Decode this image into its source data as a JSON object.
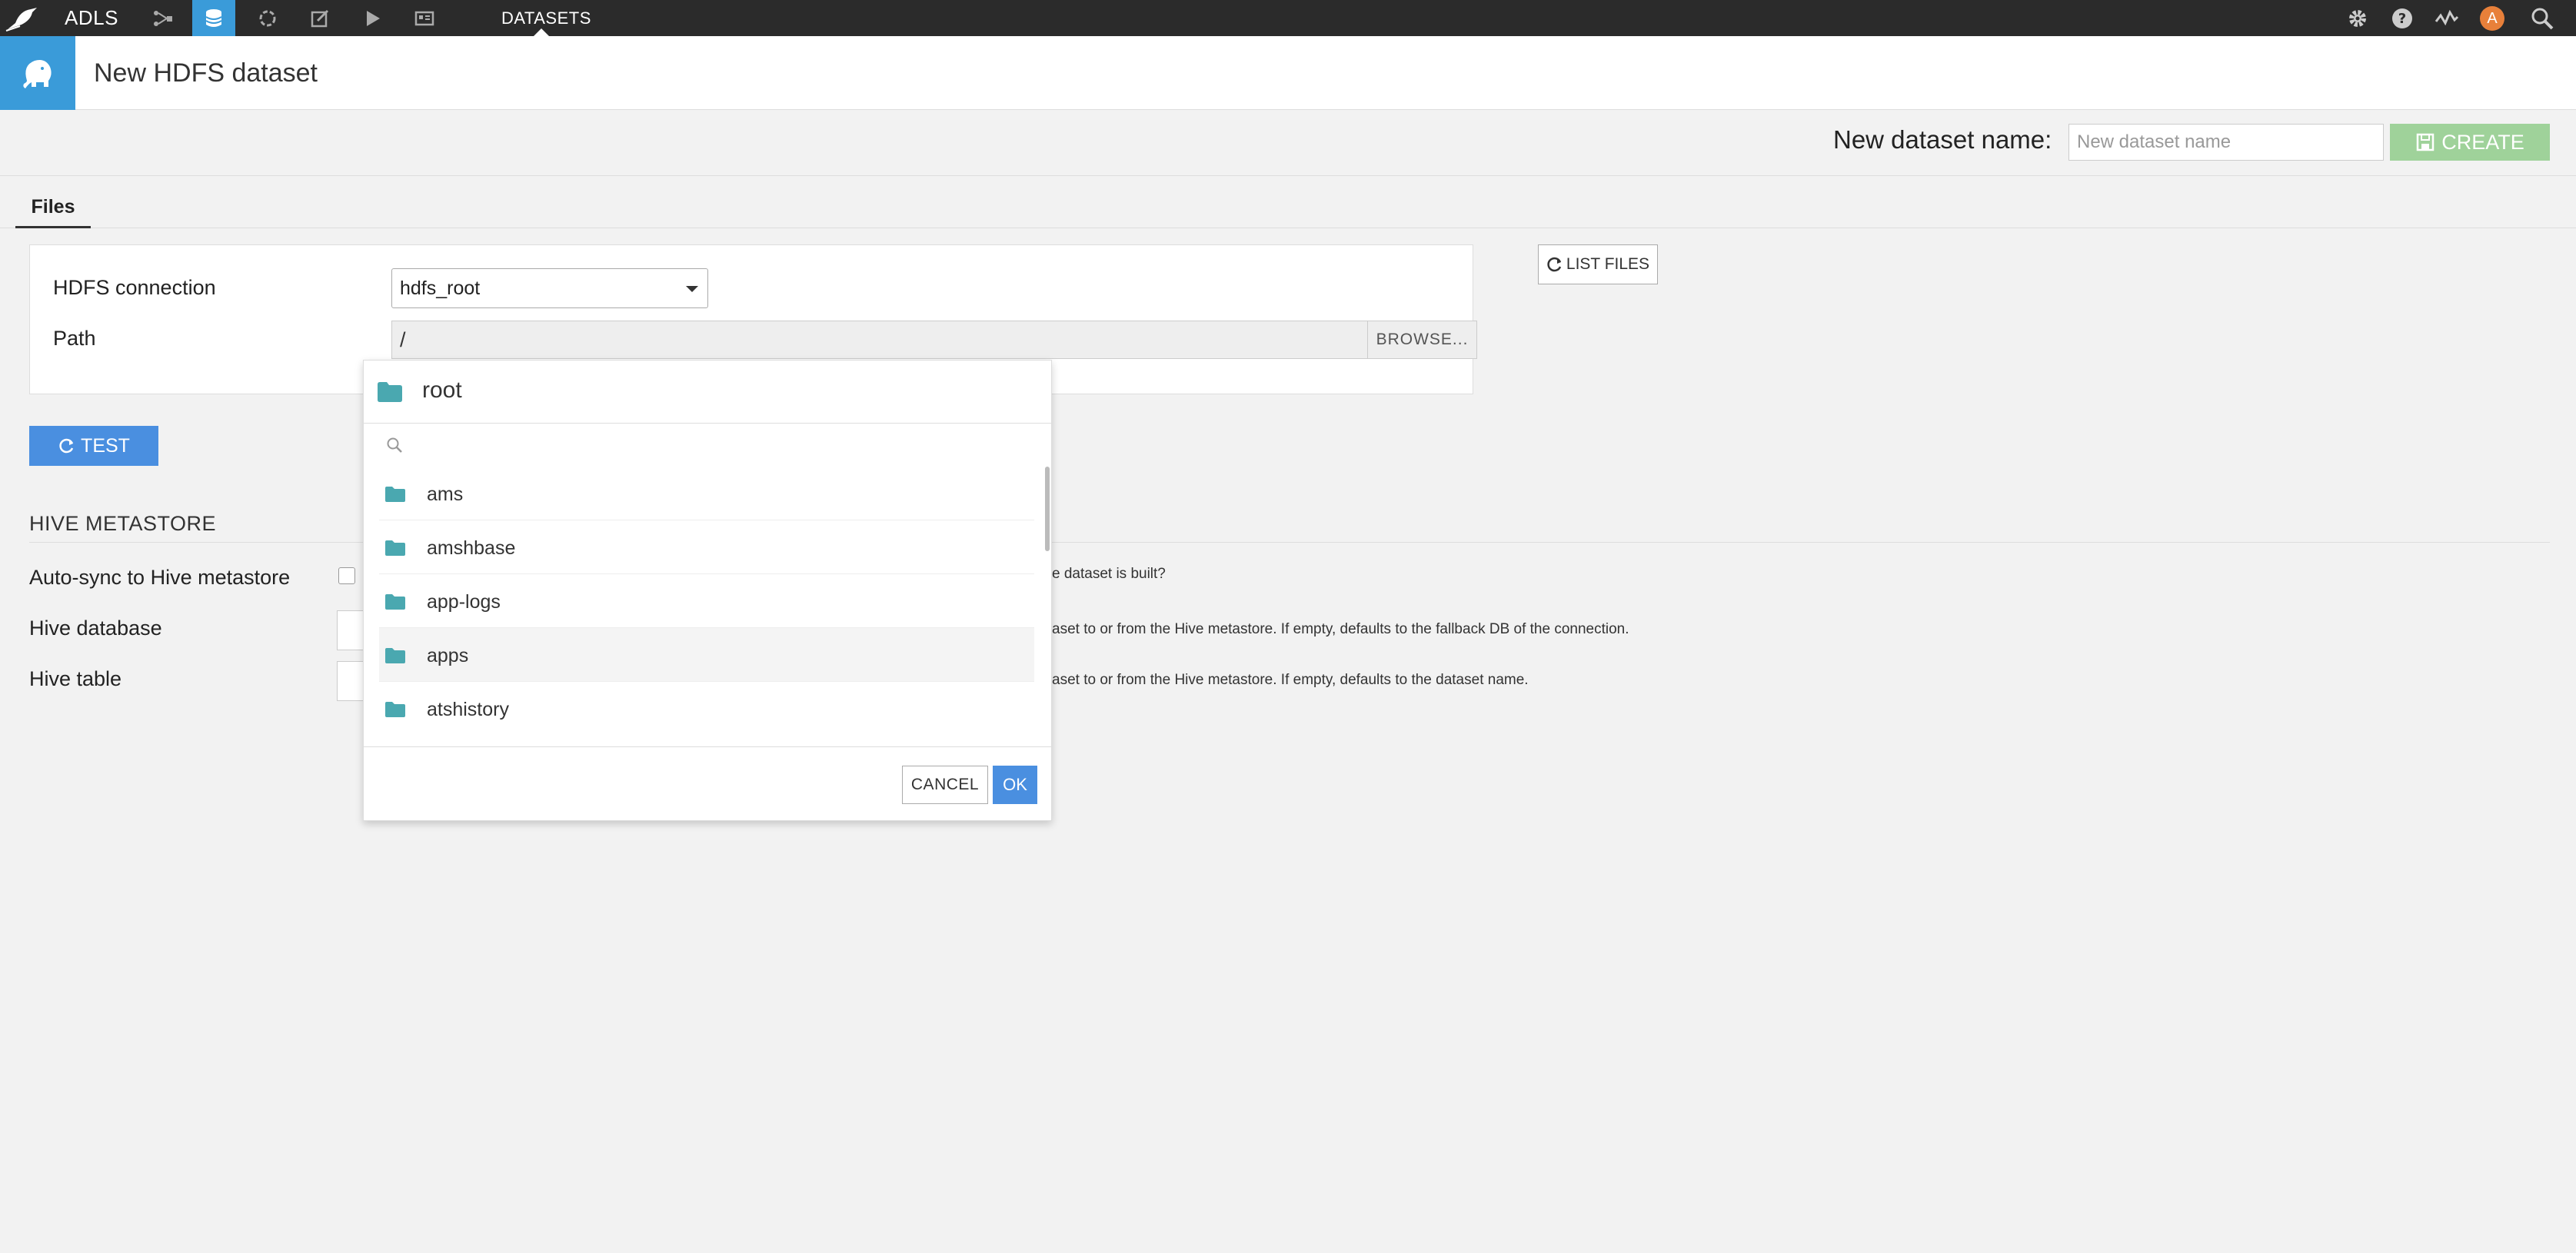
{
  "nav": {
    "project": "ADLS",
    "section": "DATASETS",
    "avatar_letter": "A"
  },
  "header": {
    "title": "New HDFS dataset"
  },
  "namebar": {
    "label": "New dataset name:",
    "placeholder": "New dataset name",
    "create_label": "CREATE"
  },
  "tabs": {
    "files": "Files"
  },
  "form": {
    "connection_label": "HDFS connection",
    "connection_value": "hdfs_root",
    "path_label": "Path",
    "path_value": "/",
    "browse_label": "BROWSE...",
    "list_files_label": "LIST FILES",
    "test_label": "TEST"
  },
  "hive": {
    "title": "HIVE METASTORE",
    "autosync_label": "Auto-sync to Hive metastore",
    "autosync_help": "e dataset is built?",
    "database_label": "Hive database",
    "database_help": "aset to or from the Hive metastore. If empty, defaults to the fallback DB of the connection.",
    "table_label": "Hive table",
    "table_help": "aset to or from the Hive metastore. If empty, defaults to the dataset name."
  },
  "browser": {
    "current_folder": "root",
    "items": [
      "ams",
      "amshbase",
      "app-logs",
      "apps",
      "atshistory"
    ],
    "cancel_label": "CANCEL",
    "ok_label": "OK"
  },
  "colors": {
    "topnav_bg": "#2b2b2b",
    "accent_blue": "#3a9bd9",
    "button_blue": "#4a8fe0",
    "create_green": "#9fd29a",
    "folder_teal": "#4aa8b0",
    "avatar_orange": "#e8803a"
  },
  "icons": {
    "logo": "bird-logo-icon",
    "flow": "flow-icon",
    "datasets": "database-icon",
    "recipes": "recipe-circle-icon",
    "notebooks": "notebook-edit-icon",
    "jobs": "play-icon",
    "dashboards": "dashboard-icon",
    "settings": "gear-icon",
    "help": "question-icon",
    "activity": "activity-icon",
    "search": "search-icon",
    "elephant": "elephant-icon",
    "folder": "folder-icon"
  }
}
